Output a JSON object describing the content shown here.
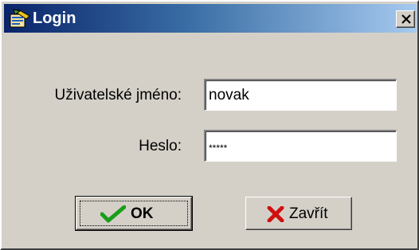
{
  "window": {
    "title": "Login",
    "app_icon": "login-app-icon",
    "close_icon": "close-icon",
    "title_colors": [
      "#0a246a",
      "#a6caf0"
    ]
  },
  "form": {
    "username_label": "Uživatelské jméno:",
    "username_value": "novak",
    "password_label": "Heslo:",
    "password_value": "*****"
  },
  "buttons": {
    "ok": {
      "label": "OK",
      "icon": "checkmark-icon",
      "icon_color": "#1a9e1a"
    },
    "close": {
      "label": "Zavřít",
      "icon": "cross-icon",
      "icon_color": "#d01010"
    }
  }
}
